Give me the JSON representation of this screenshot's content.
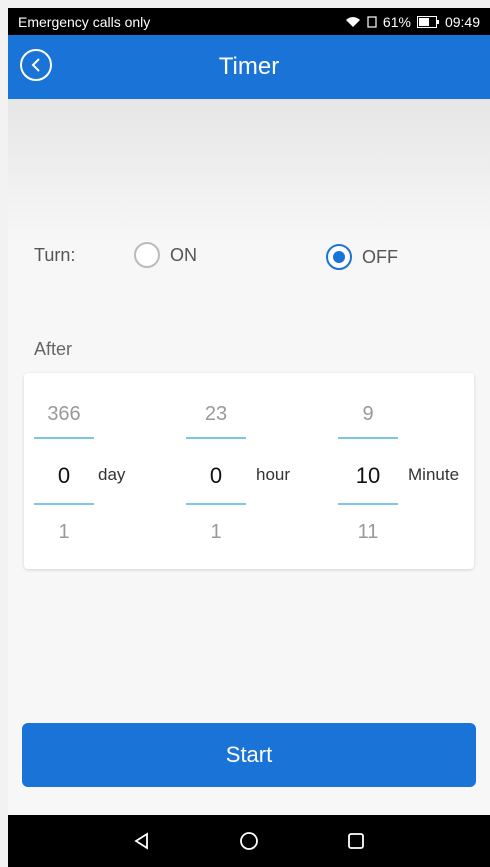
{
  "status_bar": {
    "carrier": "Emergency calls only",
    "battery": "61%",
    "time": "09:49"
  },
  "app_bar": {
    "title": "Timer"
  },
  "turn": {
    "label": "Turn:",
    "on_label": "ON",
    "off_label": "OFF",
    "selected": "OFF"
  },
  "after_label": "After",
  "picker": {
    "day": {
      "above": "366",
      "value": "0",
      "below": "1",
      "unit": "day"
    },
    "hour": {
      "above": "23",
      "value": "0",
      "below": "1",
      "unit": "hour"
    },
    "minute": {
      "above": "9",
      "value": "10",
      "below": "11",
      "unit": "Minute"
    }
  },
  "start_label": "Start",
  "colors": {
    "primary": "#1a73d6",
    "picker_line": "#7ec6e8"
  }
}
